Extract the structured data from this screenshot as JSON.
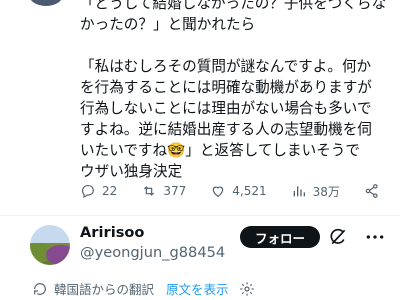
{
  "tweet": {
    "line1": "「どうして結婚しなかったの？子供をつくらな\nかったの？」と聞かれたら",
    "line2": "「私はむしろその質問が謎なんですよ。何か\nを行為することには明確な動機がありますが\n行為しないことには理由がない場合も多いで\nすよね。逆に結婚出産する人の志望動機を伺\nいたいですね🤓」と返答してしまいそうで\nウザい独身決定"
  },
  "actions": {
    "replies": "22",
    "reposts": "377",
    "likes": "4,521",
    "views": "38万"
  },
  "profile": {
    "name": "Aririsoo",
    "handle": "@yeongjun_g88454",
    "follow_label": "フォロー"
  },
  "translation": {
    "label": "韓国語からの翻訳",
    "show_original": "原文を表示"
  },
  "icons": {
    "reply": "reply-icon",
    "repost": "repost-icon",
    "like": "like-icon",
    "views": "views-icon",
    "share": "share-icon",
    "grok": "grok-icon",
    "more": "more-icon",
    "translate": "translate-icon",
    "settings": "gear-icon"
  },
  "colors": {
    "accent": "#1d9bf0",
    "text": "#0f1419",
    "muted": "#536471",
    "button_bg": "#0f1419"
  }
}
